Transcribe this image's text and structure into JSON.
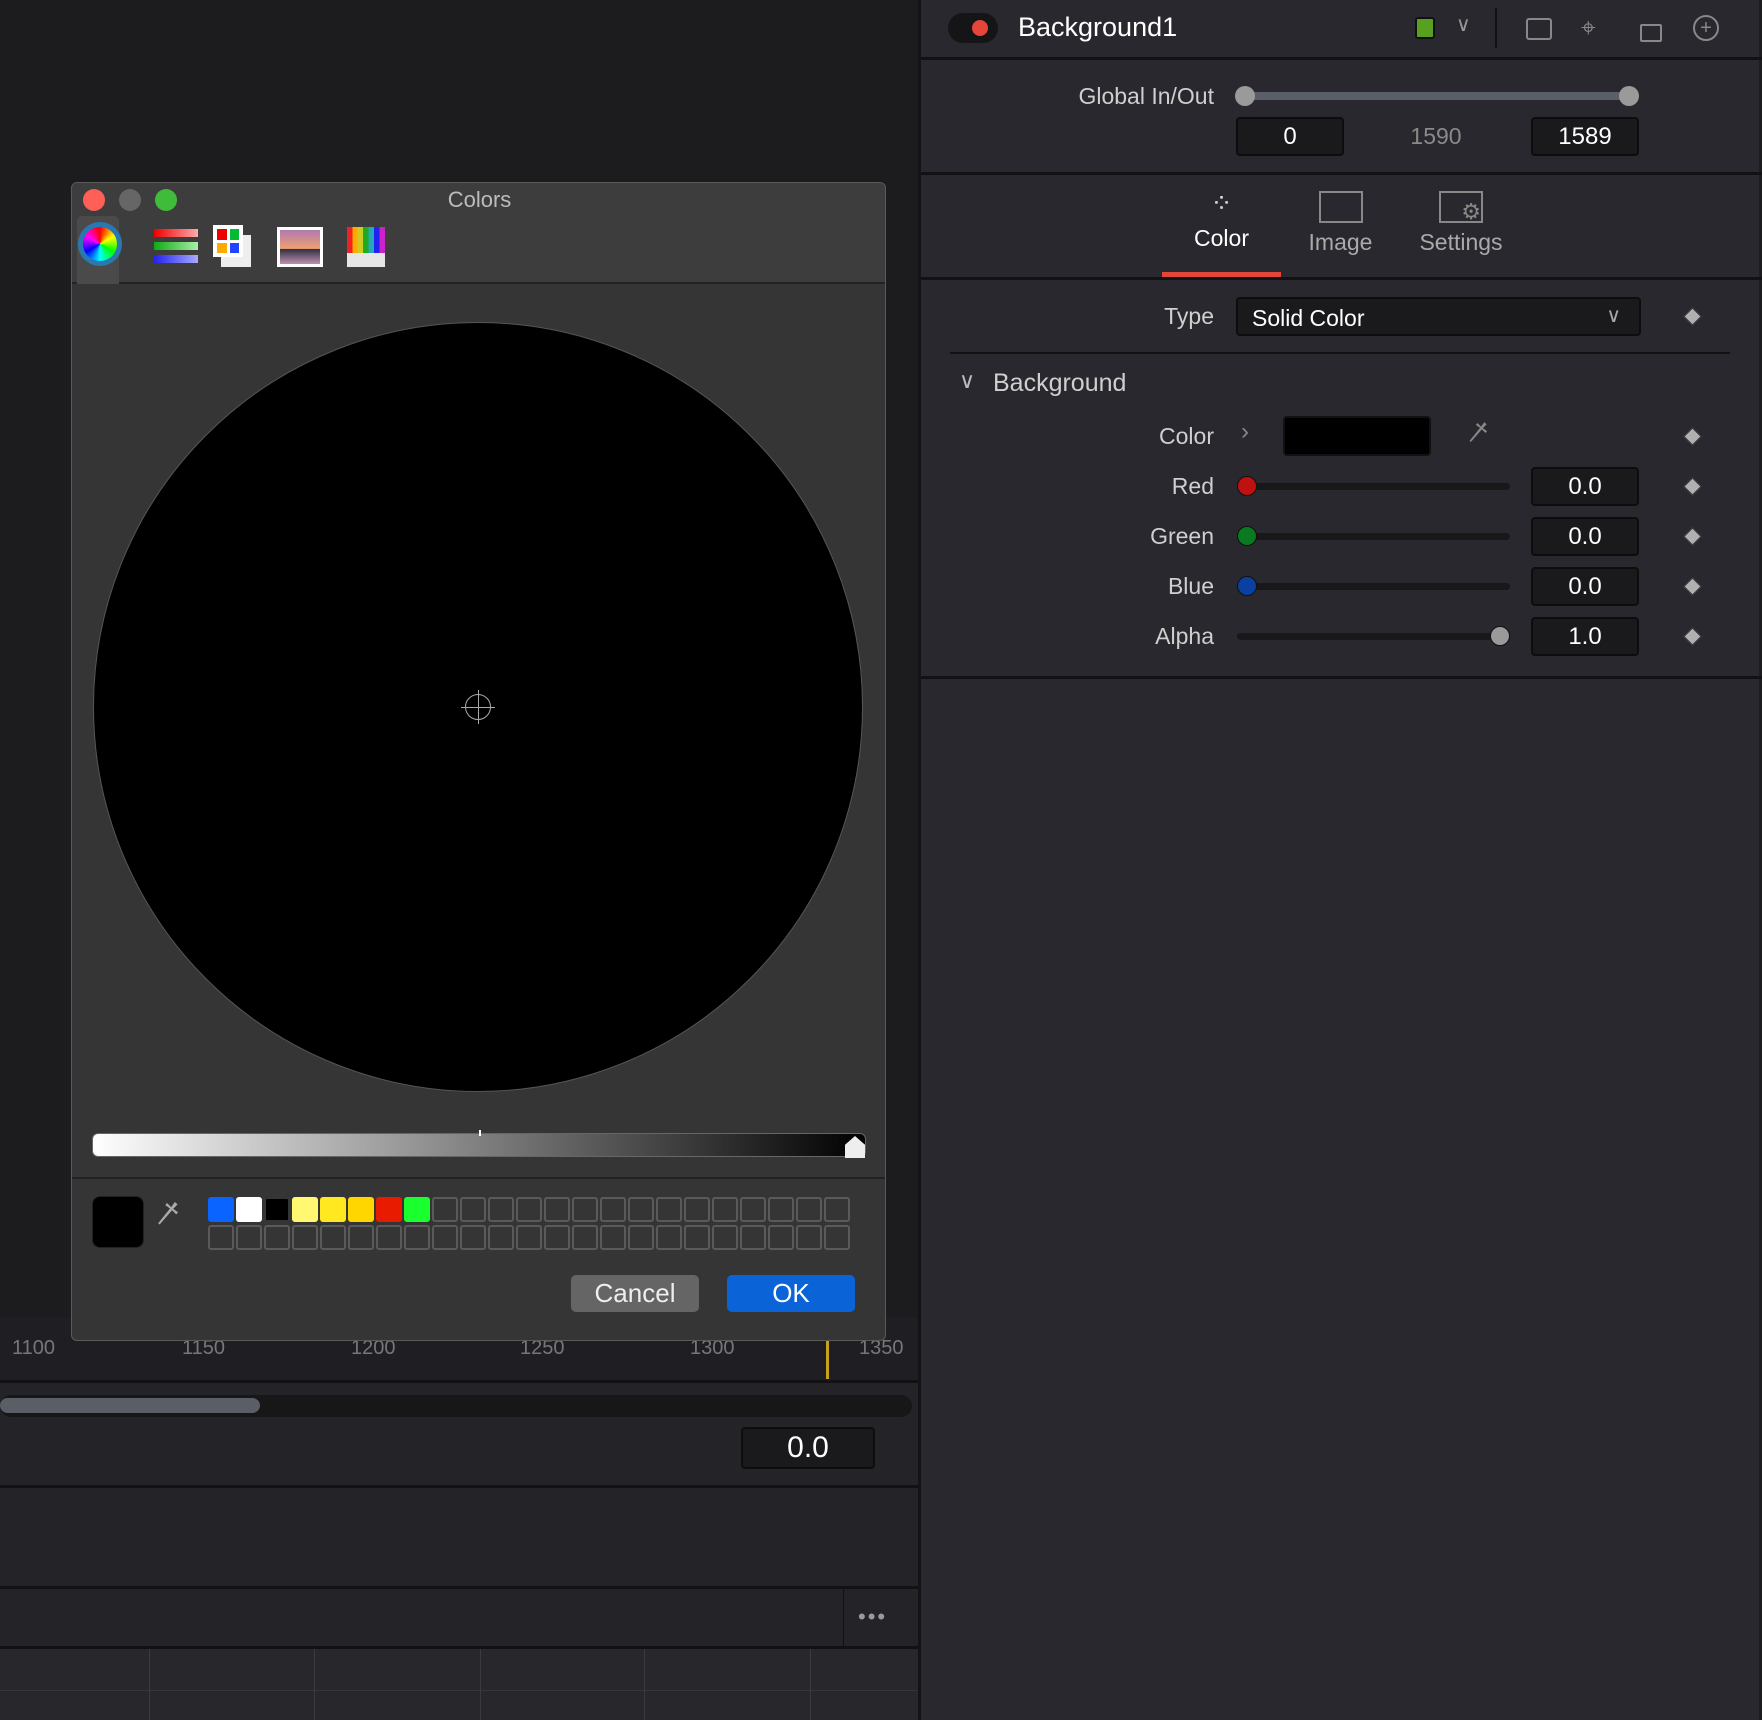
{
  "timeline": {
    "ticks": [
      "1100",
      "1150",
      "1200",
      "1250",
      "1300",
      "1350"
    ],
    "value": "0.0",
    "more_label": "•••",
    "playhead_color": "#c8a020"
  },
  "dialog": {
    "title": "Colors",
    "modes": [
      "color-wheel",
      "color-sliders",
      "color-palettes",
      "image-palettes",
      "pencils"
    ],
    "palette": [
      "#0a64ff",
      "#ffffff",
      "#000000",
      "#fff870",
      "#ffe81f",
      "#ffd600",
      "#e81a00",
      "#1aff2e"
    ],
    "current_color": "#000000",
    "cancel": "Cancel",
    "ok": "OK",
    "brightness_percent": 100
  },
  "inspector": {
    "node_name": "Background1",
    "node_color": "#5aa020",
    "global_label": "Global In/Out",
    "global_in": "0",
    "global_duration": "1590",
    "global_out": "1589",
    "tabs": [
      {
        "label": "Color",
        "active": true
      },
      {
        "label": "Image"
      },
      {
        "label": "Settings"
      }
    ],
    "type_label": "Type",
    "type_value": "Solid Color",
    "section": "Background",
    "color_label": "Color",
    "color_value": "#000000",
    "channels": [
      {
        "label": "Red",
        "value": "0.0",
        "fraction": 0,
        "color": "#c01010"
      },
      {
        "label": "Green",
        "value": "0.0",
        "fraction": 0,
        "color": "#0a7a20"
      },
      {
        "label": "Blue",
        "value": "0.0",
        "fraction": 0,
        "color": "#0a40a0"
      },
      {
        "label": "Alpha",
        "value": "1.0",
        "fraction": 1,
        "color": "#9a9a9a"
      }
    ]
  }
}
